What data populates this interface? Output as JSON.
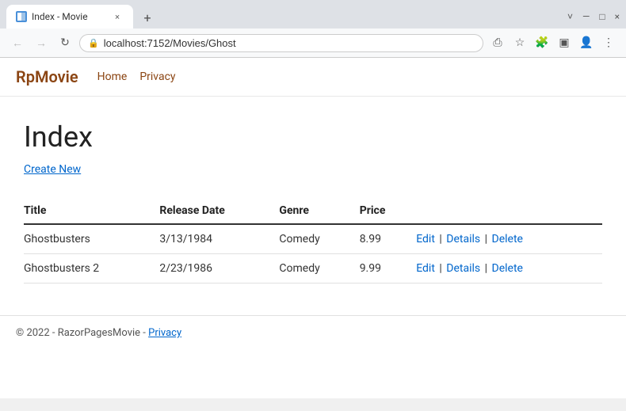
{
  "browser": {
    "tab": {
      "favicon_label": "M",
      "title": "Index - Movie",
      "close_label": "×",
      "new_tab_label": "+"
    },
    "window_controls": {
      "chevron": "˅",
      "minimize": "—",
      "maximize": "□",
      "close": "×"
    },
    "nav": {
      "back_label": "←",
      "forward_label": "→",
      "reload_label": "↻"
    },
    "address": "localhost:7152/Movies/Ghost",
    "toolbar_icons": {
      "share": "⎙",
      "star": "☆",
      "extension": "🧩",
      "sidebar": "▣",
      "profile": "👤",
      "menu": "⋮"
    }
  },
  "site": {
    "brand_prefix": "Rp",
    "brand_suffix": "Movie",
    "nav_links": [
      {
        "label": "Home",
        "href": "#"
      },
      {
        "label": "Privacy",
        "href": "#"
      }
    ]
  },
  "page": {
    "heading": "Index",
    "create_new_label": "Create New",
    "table": {
      "columns": [
        "Title",
        "Release Date",
        "Genre",
        "Price"
      ],
      "rows": [
        {
          "title": "Ghostbusters",
          "release_date": "3/13/1984",
          "genre": "Comedy",
          "price": "8.99"
        },
        {
          "title": "Ghostbusters 2",
          "release_date": "2/23/1986",
          "genre": "Comedy",
          "price": "9.99"
        }
      ],
      "actions": [
        "Edit",
        "Details",
        "Delete"
      ]
    }
  },
  "footer": {
    "copyright": "© 2022 - RazorPagesMovie - ",
    "privacy_label": "Privacy"
  }
}
